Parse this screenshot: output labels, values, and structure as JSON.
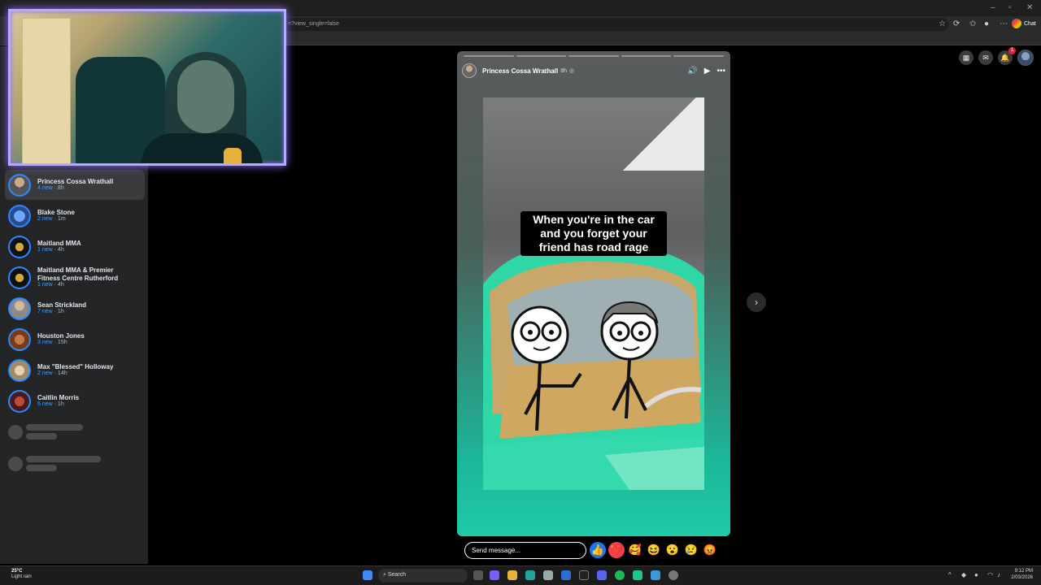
{
  "browser": {
    "url": "=?view_single=false",
    "chat_label": "Chat"
  },
  "sidebar": {
    "stories": [
      {
        "name": "Princess Cossa Wrathall",
        "new": "4 new",
        "time": "8h"
      },
      {
        "name": "Blake Stone",
        "new": "2 new",
        "time": "1m"
      },
      {
        "name": "Maitland MMA",
        "new": "1 new",
        "time": "4h"
      },
      {
        "name": "Maitland MMA & Premier Fitness Centre Rutherford",
        "new": "1 new",
        "time": "4h"
      },
      {
        "name": "Sean Strickland",
        "new": "7 new",
        "time": "1h"
      },
      {
        "name": "Houston Jones",
        "new": "3 new",
        "time": "15h"
      },
      {
        "name": "Max \"Blessed\" Holloway",
        "new": "2 new",
        "time": "14h"
      },
      {
        "name": "Caitlin Morris",
        "new": "6 new",
        "time": "1h"
      }
    ]
  },
  "header": {
    "notification_count": "1"
  },
  "story": {
    "author": "Princess Cossa Wrathall",
    "time": "8h",
    "caption": "When you're in the car and you forget your friend has road rage",
    "progress_segments": 5,
    "progress_done": 0
  },
  "reply": {
    "placeholder": "Send message..."
  },
  "reactions": [
    "👍",
    "❤️",
    "🥰",
    "😆",
    "😮",
    "😢",
    "😡"
  ],
  "taskbar": {
    "temp": "25°C",
    "weather": "Light rain",
    "search": "Search",
    "time": "9:12 PM",
    "date": "2/03/2026"
  }
}
